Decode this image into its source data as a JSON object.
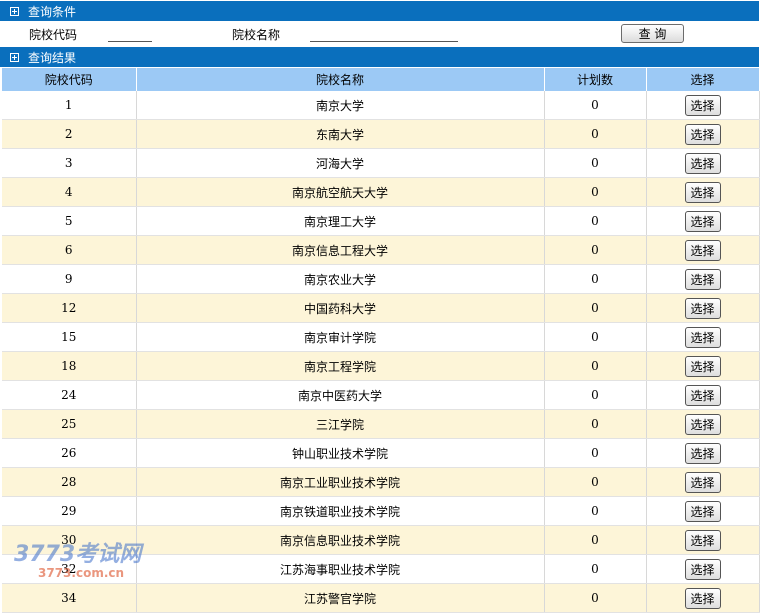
{
  "query_section": {
    "title": "查询条件",
    "code_label": "院校代码",
    "code_value": "",
    "name_label": "院校名称",
    "name_value": "",
    "query_button": "查 询"
  },
  "results_section": {
    "title": "查询结果",
    "columns": [
      "院校代码",
      "院校名称",
      "计划数",
      "选择"
    ],
    "select_label": "选择",
    "rows": [
      {
        "code": "1",
        "name": "南京大学",
        "plan": "0"
      },
      {
        "code": "2",
        "name": "东南大学",
        "plan": "0"
      },
      {
        "code": "3",
        "name": "河海大学",
        "plan": "0"
      },
      {
        "code": "4",
        "name": "南京航空航天大学",
        "plan": "0"
      },
      {
        "code": "5",
        "name": "南京理工大学",
        "plan": "0"
      },
      {
        "code": "6",
        "name": "南京信息工程大学",
        "plan": "0"
      },
      {
        "code": "9",
        "name": "南京农业大学",
        "plan": "0"
      },
      {
        "code": "12",
        "name": "中国药科大学",
        "plan": "0"
      },
      {
        "code": "15",
        "name": "南京审计学院",
        "plan": "0"
      },
      {
        "code": "18",
        "name": "南京工程学院",
        "plan": "0"
      },
      {
        "code": "24",
        "name": "南京中医药大学",
        "plan": "0"
      },
      {
        "code": "25",
        "name": "三江学院",
        "plan": "0"
      },
      {
        "code": "26",
        "name": "钟山职业技术学院",
        "plan": "0"
      },
      {
        "code": "28",
        "name": "南京工业职业技术学院",
        "plan": "0"
      },
      {
        "code": "29",
        "name": "南京铁道职业技术学院",
        "plan": "0"
      },
      {
        "code": "30",
        "name": "南京信息职业技术学院",
        "plan": "0"
      },
      {
        "code": "32",
        "name": "江苏海事职业技术学院",
        "plan": "0"
      },
      {
        "code": "34",
        "name": "江苏警官学院",
        "plan": "0"
      }
    ]
  },
  "watermark": {
    "main": "3773考试网",
    "sub": "3773.com.cn"
  }
}
